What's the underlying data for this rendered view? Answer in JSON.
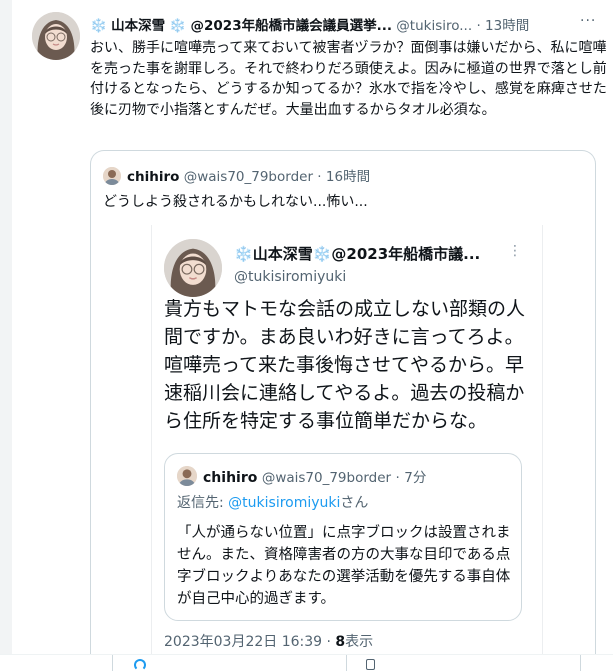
{
  "tweet": {
    "snow_left": "❄️",
    "display_name": "山本深雪",
    "snow_right": "❄️",
    "display_suffix": "@2023年船橋市議会議員選挙...",
    "handle": "@tukisiro...",
    "sep": "·",
    "time": "13時間",
    "more": "···",
    "body": "おい、勝手に喧嘩売って来ておいて被害者ヅラか？面倒事は嫌いだから、私に喧嘩を売った事を謝罪しろ。それで終わりだろ頭使えよ。因みに極道の世界で落とし前付けるとなったら、どうするか知ってるか？氷水で指を冷やし、感覚を麻痺させた後に刃物で小指落とすんだぜ。大量出血するからタオル必須な。"
  },
  "quote": {
    "name": "chihiro",
    "handle": "@wais70_79border",
    "sep": "·",
    "time": "16時間",
    "body": "どうしよう殺されるかもしれない...怖い..."
  },
  "card": {
    "snow_left": "❄️",
    "display_name": "山本深雪",
    "snow_right": "❄️",
    "display_suffix": "@2023年船橋市議...",
    "handle": "@tukisiromiyuki",
    "more": "⋮",
    "body": "貴方もマトモな会話の成立しない部類の人間ですか。まあ良いわ好きに言ってろよ。喧嘩売って来た事後悔させてやるから。早速稲川会に連絡してやるよ。過去の投稿から住所を特定する事位簡単だからな。",
    "date": "2023年03月22日 16:39",
    "sep": "·",
    "views_count": "8",
    "views_label": "表示"
  },
  "inner": {
    "name": "chihiro",
    "handle": "@wais70_79border",
    "sep": "·",
    "time": "7分",
    "reply_prefix": "返信先: ",
    "reply_mention": "@tukisiromiyuki",
    "reply_suffix": "さん",
    "body": "「人が通らない位置」に点字ブロックは設置されません。また、資格障害者の方の大事な目印である点字ブロックよりあなたの選挙活動を優先する事自体が自己中心的過ぎます。"
  },
  "colors": {
    "accent": "#1d9bf0",
    "muted": "#536471",
    "snowflake": "#4aa3df"
  }
}
